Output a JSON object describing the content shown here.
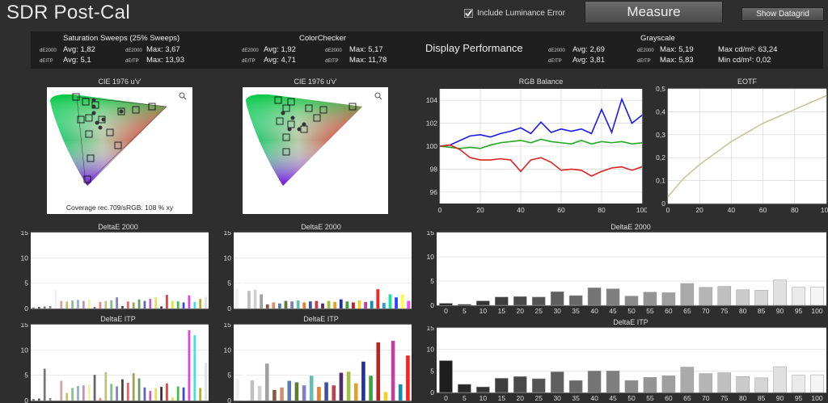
{
  "app": {
    "title": "SDR Post-Cal"
  },
  "toolbar": {
    "include_luminance_error": "Include Luminance Error",
    "measure": "Measure",
    "show_datagrid": "Show Datagrid"
  },
  "summary": {
    "saturation": {
      "title": "Saturation Sweeps (25% Sweeps)",
      "de2000_label": "dE2000",
      "deitp_label": "dEITP",
      "de2000_avg": "Avg: 1,82",
      "de2000_max": "Max: 3,67",
      "deitp_avg": "Avg: 5,1",
      "deitp_max": "Max: 13,93"
    },
    "colorchecker": {
      "title": "ColorChecker",
      "de2000_label": "dE2000",
      "deitp_label": "dEITP",
      "de2000_avg": "Avg: 1,92",
      "de2000_max": "Max: 5,17",
      "deitp_avg": "Avg: 4,71",
      "deitp_max": "Max: 11,78"
    },
    "display_performance": "Display Performance",
    "dp": {
      "de2000_label": "dE2000",
      "deitp_label": "dEITP",
      "de2000_avg": "Avg: 2,69",
      "deitp_avg": "Avg: 3,81"
    },
    "grayscale": {
      "title": "Grayscale",
      "de2000_label": "dE2000",
      "deitp_label": "dEITP",
      "de2000_max": "Max: 5,19",
      "deitp_max": "Max: 5,83",
      "max_cd": "Max cd/m²:  63,24",
      "min_cd": "Min cd/m²:  0,02"
    }
  },
  "cie": {
    "left_title": "CIE 1976 u'v'",
    "right_title": "CIE 1976 u'v'",
    "coverage": "Coverage rec.709/sRGB:  108 % xy"
  },
  "chart_data": [
    {
      "type": "line",
      "title": "RGB Balance",
      "xlim": [
        0,
        100
      ],
      "ylim": [
        95,
        105
      ],
      "xticks": [
        0,
        20,
        40,
        60,
        80,
        100
      ],
      "yticks": [
        96,
        98,
        100,
        102,
        104
      ],
      "x": [
        0,
        5,
        10,
        15,
        20,
        25,
        30,
        35,
        40,
        45,
        50,
        55,
        60,
        65,
        70,
        75,
        80,
        85,
        90,
        95,
        100
      ],
      "series": [
        {
          "color": "#1a1aee",
          "values": [
            100,
            100.1,
            100.5,
            100.9,
            101,
            100.8,
            101.1,
            101.3,
            101.6,
            101.1,
            102.1,
            101.2,
            101.5,
            101.3,
            101.5,
            101.1,
            103.2,
            101.2,
            104.1,
            102.0,
            102.7
          ]
        },
        {
          "color": "#22aa22",
          "values": [
            100,
            99.9,
            99.8,
            99.9,
            99.8,
            100.1,
            100.3,
            100.4,
            100.5,
            100.3,
            100.6,
            100.4,
            100.3,
            100.2,
            100.5,
            100.2,
            100.4,
            100.3,
            100.4,
            100.2,
            100.3
          ]
        },
        {
          "color": "#dd2222",
          "values": [
            100,
            100.1,
            99.7,
            99.0,
            98.8,
            98.8,
            98.9,
            98.8,
            97.8,
            98.8,
            99.0,
            98.6,
            97.9,
            98.0,
            97.9,
            97.4,
            97.8,
            98.1,
            98.2,
            97.9,
            98.2
          ]
        }
      ]
    },
    {
      "type": "line",
      "title": "EOTF",
      "xlim": [
        0,
        100
      ],
      "ylim": [
        0,
        0.5
      ],
      "xticks": [
        0,
        20,
        40,
        60,
        80,
        100
      ],
      "yticks": [
        0,
        0.1,
        0.2,
        0.3,
        0.4,
        0.5
      ],
      "ytick_labels": [
        "0",
        "0,1",
        "0,2",
        "0,3",
        "0,4",
        "0,5"
      ],
      "x": [
        0,
        5,
        10,
        20,
        30,
        40,
        50,
        60,
        70,
        80,
        90,
        100
      ],
      "series": [
        {
          "color": "#c8c49a",
          "values": [
            0.03,
            0.07,
            0.11,
            0.17,
            0.22,
            0.27,
            0.31,
            0.35,
            0.38,
            0.41,
            0.44,
            0.47
          ]
        }
      ]
    },
    {
      "type": "bar",
      "title": "DeltaE 2000",
      "ylim": [
        0,
        15
      ],
      "yticks": [
        0,
        5,
        10,
        15
      ],
      "categories": [
        "0",
        "5",
        "10",
        "15",
        "20",
        "25",
        "30",
        "35",
        "40",
        "45",
        "50",
        "55",
        "60",
        "65",
        "70",
        "75",
        "80",
        "85",
        "90",
        "95",
        "100"
      ],
      "values": [
        0.4,
        0.2,
        0.9,
        1.7,
        1.8,
        1.7,
        2.8,
        2.0,
        3.6,
        3.4,
        1.9,
        2.7,
        2.6,
        4.5,
        3.7,
        3.9,
        3.2,
        3.1,
        5.2,
        3.7,
        3.8
      ]
    },
    {
      "type": "bar",
      "title": "DeltaE ITP",
      "ylim": [
        0,
        15
      ],
      "yticks": [
        0,
        5,
        10,
        15
      ],
      "categories": [
        "0",
        "5",
        "10",
        "15",
        "20",
        "25",
        "30",
        "35",
        "40",
        "45",
        "50",
        "55",
        "60",
        "65",
        "70",
        "75",
        "80",
        "85",
        "90",
        "95",
        "100"
      ],
      "values": [
        7.4,
        1.9,
        1.3,
        3.3,
        3.7,
        3.2,
        4.8,
        2.8,
        5.0,
        5.0,
        2.8,
        3.5,
        3.9,
        5.9,
        4.4,
        4.6,
        3.7,
        3.4,
        6.0,
        4.0,
        4.1
      ]
    },
    {
      "type": "bar",
      "title": "DeltaE 2000",
      "ylim": [
        0,
        15
      ],
      "yticks": [
        0,
        5,
        10,
        15
      ],
      "values": [
        0.2,
        0.3,
        0.4,
        0.5,
        3.6,
        1.5,
        1.4,
        1.6,
        1.7,
        1.5,
        1.8,
        0.3,
        1.3,
        1.5,
        1.6,
        2.2,
        0.5,
        1.4,
        1.2,
        1.8,
        1.5,
        1.9,
        2.2,
        0.4,
        2.7,
        1.5,
        1.4,
        1.2,
        2.6,
        1.3,
        1.9,
        2.3
      ]
    },
    {
      "type": "bar",
      "title": "DeltaE 2000",
      "ylim": [
        0,
        15
      ],
      "yticks": [
        0,
        5,
        10,
        15
      ],
      "values": [
        3.9,
        5.1,
        3.5,
        3.7,
        2.8,
        0.8,
        1.2,
        1.0,
        1.5,
        1.4,
        1.6,
        1.2,
        1.4,
        1.5,
        1.0,
        1.5,
        1.3,
        1.8,
        1.4,
        1.2,
        1.6,
        1.3,
        1.5,
        3.8,
        1.1,
        2.8,
        2.2,
        2.8,
        1.5
      ]
    },
    {
      "type": "bar",
      "title": "DeltaE ITP",
      "ylim": [
        0,
        15
      ],
      "yticks": [
        0,
        5,
        10,
        15
      ],
      "values": [
        0.3,
        0.4,
        6.3,
        0.5,
        0.4,
        3.9,
        1.5,
        2.5,
        2.9,
        3.0,
        3.1,
        5.1,
        0.5,
        5.6,
        3.3,
        2.8,
        4.2,
        3.5,
        5.4,
        4.4,
        2.6,
        1.9,
        2.5,
        2.7,
        3.4,
        0.6,
        2.8,
        2.6,
        13.9,
        12.9,
        2.5,
        7.4
      ]
    },
    {
      "type": "bar",
      "title": "DeltaE ITP",
      "ylim": [
        0,
        15
      ],
      "yticks": [
        0,
        5,
        10,
        15
      ],
      "values": [
        4.3,
        6.2,
        4.0,
        2.9,
        7.3,
        2.1,
        2.6,
        3.9,
        3.6,
        3.0,
        4.9,
        2.7,
        3.6,
        3.0,
        5.5,
        5.7,
        3.4,
        7.7,
        4.9,
        11.5,
        1.7,
        11.8,
        3.2,
        8.9
      ]
    }
  ]
}
